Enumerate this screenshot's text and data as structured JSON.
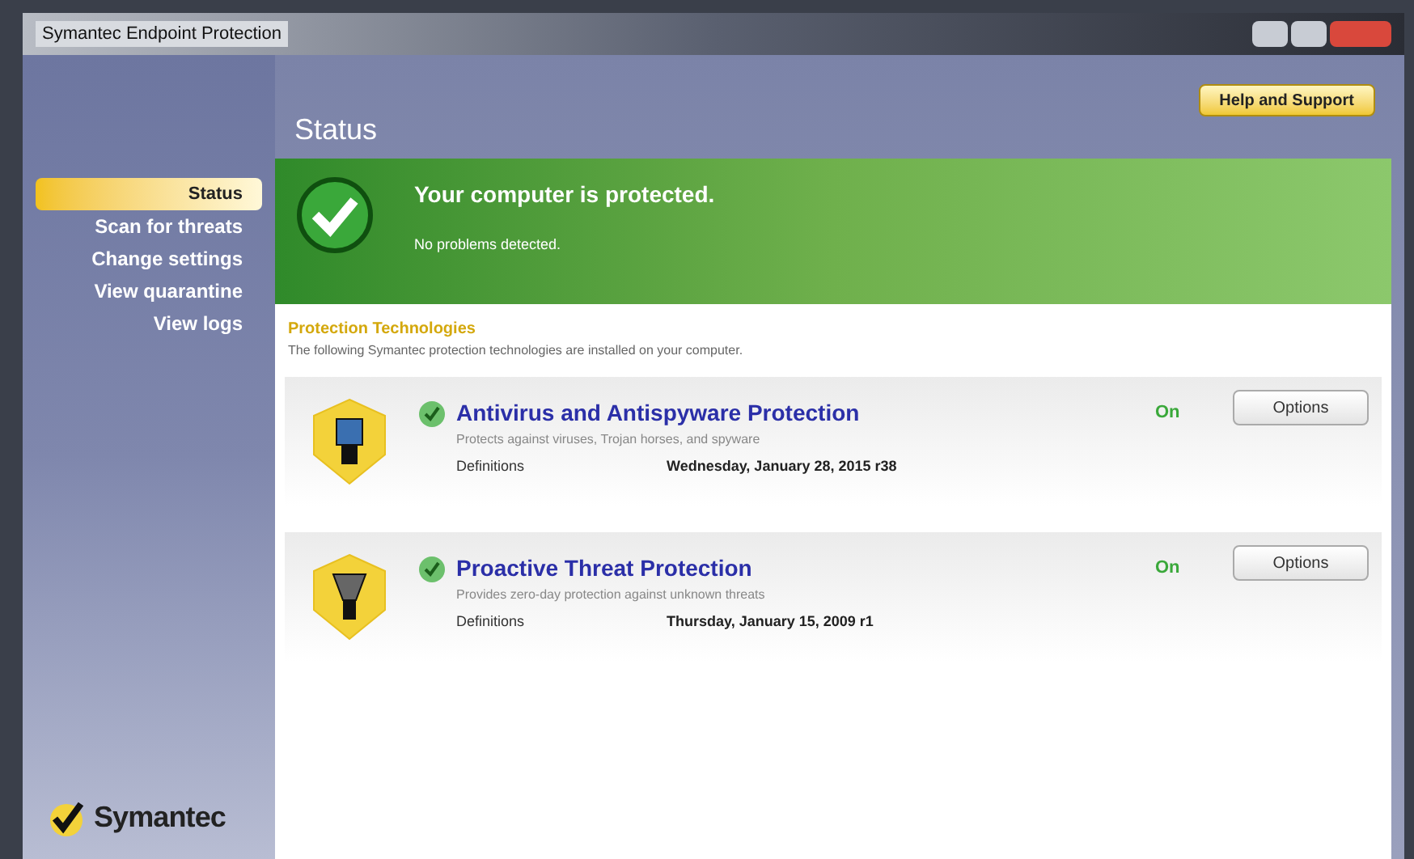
{
  "window": {
    "title": "Symantec Endpoint Protection"
  },
  "header": {
    "title": "Status",
    "help_button": "Help and Support"
  },
  "sidebar": {
    "items": [
      {
        "label": "Status",
        "selected": true
      },
      {
        "label": "Scan for threats",
        "selected": false
      },
      {
        "label": "Change settings",
        "selected": false
      },
      {
        "label": "View quarantine",
        "selected": false
      },
      {
        "label": "View logs",
        "selected": false
      }
    ],
    "logo": "Symantec"
  },
  "banner": {
    "title": "Your computer is protected.",
    "subtitle": "No problems detected."
  },
  "section": {
    "title": "Protection Technologies",
    "description": "The following Symantec protection technologies are installed on your computer."
  },
  "technologies": [
    {
      "name": "Antivirus and Antispyware Protection",
      "description": "Protects against viruses, Trojan horses, and spyware",
      "status": "On",
      "definitions_label": "Definitions",
      "definitions": "Wednesday, January 28, 2015 r38",
      "button": "Options"
    },
    {
      "name": "Proactive Threat Protection",
      "description": "Provides zero-day protection against unknown threats",
      "status": "On",
      "definitions_label": "Definitions",
      "definitions": "Thursday, January 15, 2009 r1",
      "button": "Options"
    }
  ]
}
